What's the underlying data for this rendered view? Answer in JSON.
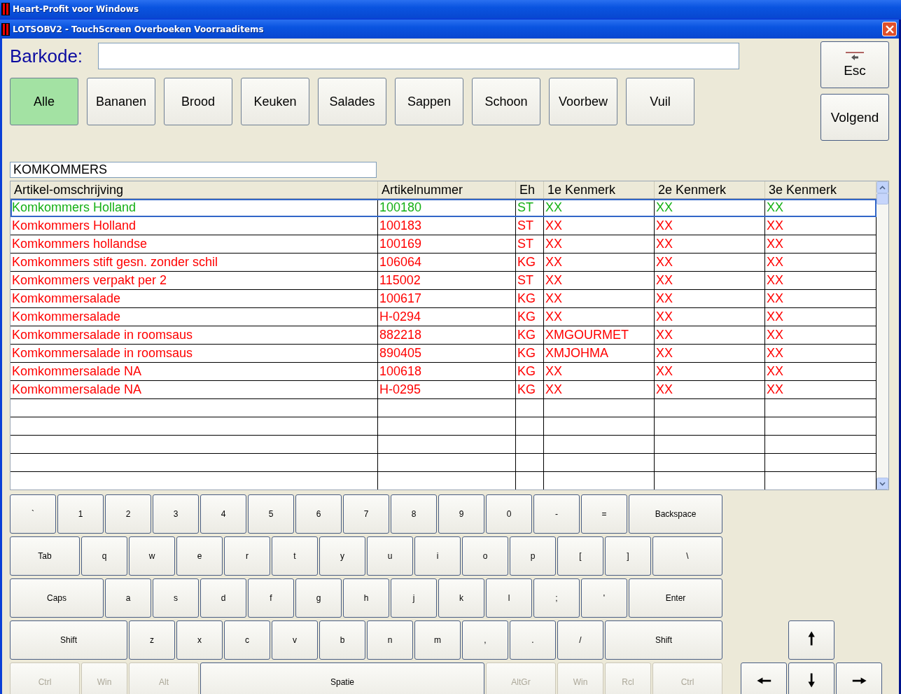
{
  "app_title": "Heart-Profit voor Windows",
  "window": {
    "title": "LOTSOBV2 - TouchScreen Overboeken Voorraaditems"
  },
  "barcode": {
    "label": "Barkode:"
  },
  "categories": [
    {
      "label": "Alle",
      "selected": true
    },
    {
      "label": "Bananen",
      "selected": false
    },
    {
      "label": "Brood",
      "selected": false
    },
    {
      "label": "Keuken",
      "selected": false
    },
    {
      "label": "Salades",
      "selected": false
    },
    {
      "label": "Sappen",
      "selected": false
    },
    {
      "label": "Schoon",
      "selected": false
    },
    {
      "label": "Voorbew",
      "selected": false
    },
    {
      "label": "Vuil",
      "selected": false
    }
  ],
  "side_buttons": [
    "Esc",
    "Volgend"
  ],
  "search": {
    "value": "KOMKOMMERS"
  },
  "table": {
    "columns": [
      "Artikel-omschrijving",
      "Artikelnummer",
      "Eh",
      "1e Kenmerk",
      "2e Kenmerk",
      "3e Kenmerk"
    ],
    "rows": [
      {
        "selected": true,
        "cells": [
          "Komkommers Holland",
          "100180",
          "ST",
          "XX",
          "XX",
          "XX"
        ]
      },
      {
        "selected": false,
        "cells": [
          "Komkommers Holland",
          "100183",
          "ST",
          "XX",
          "XX",
          "XX"
        ]
      },
      {
        "selected": false,
        "cells": [
          "Komkommers hollandse",
          "100169",
          "ST",
          "XX",
          "XX",
          "XX"
        ]
      },
      {
        "selected": false,
        "cells": [
          "Komkommers stift gesn. zonder schil",
          "106064",
          "KG",
          "XX",
          "XX",
          "XX"
        ]
      },
      {
        "selected": false,
        "cells": [
          "Komkommers verpakt per 2",
          "115002",
          "ST",
          "XX",
          "XX",
          "XX"
        ]
      },
      {
        "selected": false,
        "cells": [
          "Komkommersalade",
          "100617",
          "KG",
          "XX",
          "XX",
          "XX"
        ]
      },
      {
        "selected": false,
        "cells": [
          "Komkommersalade",
          "H-0294",
          "KG",
          "XX",
          "XX",
          "XX"
        ]
      },
      {
        "selected": false,
        "cells": [
          "Komkommersalade in roomsaus",
          "882218",
          "KG",
          "XMGOURMET",
          "XX",
          "XX"
        ]
      },
      {
        "selected": false,
        "cells": [
          "Komkommersalade in roomsaus",
          "890405",
          "KG",
          "XMJOHMA",
          "XX",
          "XX"
        ]
      },
      {
        "selected": false,
        "cells": [
          "Komkommersalade NA",
          "100618",
          "KG",
          "XX",
          "XX",
          "XX"
        ]
      },
      {
        "selected": false,
        "cells": [
          "Komkommersalade NA",
          "H-0295",
          "KG",
          "XX",
          "XX",
          "XX"
        ]
      }
    ]
  },
  "keyboard": [
    [
      {
        "label": "`",
        "kind": "key",
        "disabled": false
      },
      {
        "label": "1",
        "kind": "key",
        "disabled": false
      },
      {
        "label": "2",
        "kind": "key",
        "disabled": false
      },
      {
        "label": "3",
        "kind": "key",
        "disabled": false
      },
      {
        "label": "4",
        "kind": "key",
        "disabled": false
      },
      {
        "label": "5",
        "kind": "key",
        "disabled": false
      },
      {
        "label": "6",
        "kind": "key",
        "disabled": false
      },
      {
        "label": "7",
        "kind": "key",
        "disabled": false
      },
      {
        "label": "8",
        "kind": "key",
        "disabled": false
      },
      {
        "label": "9",
        "kind": "key",
        "disabled": false
      },
      {
        "label": "0",
        "kind": "key",
        "disabled": false
      },
      {
        "label": "-",
        "kind": "key",
        "disabled": false
      },
      {
        "label": "=",
        "kind": "key",
        "disabled": false
      },
      {
        "label": "Backspace",
        "kind": "wide",
        "disabled": false
      }
    ],
    [
      {
        "label": "Tab",
        "kind": "medium",
        "disabled": false
      },
      {
        "label": "q",
        "kind": "key",
        "disabled": false
      },
      {
        "label": "w",
        "kind": "key",
        "disabled": false
      },
      {
        "label": "e",
        "kind": "key",
        "disabled": false
      },
      {
        "label": "r",
        "kind": "key",
        "disabled": false
      },
      {
        "label": "t",
        "kind": "key",
        "disabled": false
      },
      {
        "label": "y",
        "kind": "key",
        "disabled": false
      },
      {
        "label": "u",
        "kind": "key",
        "disabled": false
      },
      {
        "label": "i",
        "kind": "key",
        "disabled": false
      },
      {
        "label": "o",
        "kind": "key",
        "disabled": false
      },
      {
        "label": "p",
        "kind": "key",
        "disabled": false
      },
      {
        "label": "[",
        "kind": "key",
        "disabled": false
      },
      {
        "label": "]",
        "kind": "key",
        "disabled": false
      },
      {
        "label": "\\",
        "kind": "medium",
        "disabled": false
      }
    ],
    [
      {
        "label": "Caps",
        "kind": "wide",
        "disabled": false
      },
      {
        "label": "a",
        "kind": "key",
        "disabled": false
      },
      {
        "label": "s",
        "kind": "key",
        "disabled": false
      },
      {
        "label": "d",
        "kind": "key",
        "disabled": false
      },
      {
        "label": "f",
        "kind": "key",
        "disabled": false
      },
      {
        "label": "g",
        "kind": "key",
        "disabled": false
      },
      {
        "label": "h",
        "kind": "key",
        "disabled": false
      },
      {
        "label": "j",
        "kind": "key",
        "disabled": false
      },
      {
        "label": "k",
        "kind": "key",
        "disabled": false
      },
      {
        "label": "l",
        "kind": "key",
        "disabled": false
      },
      {
        "label": ";",
        "kind": "key",
        "disabled": false
      },
      {
        "label": "'",
        "kind": "key",
        "disabled": false
      },
      {
        "label": "Enter",
        "kind": "wide",
        "disabled": false
      }
    ],
    [
      {
        "label": "Shift",
        "kind": "shift",
        "disabled": false
      },
      {
        "label": "z",
        "kind": "key",
        "disabled": false
      },
      {
        "label": "x",
        "kind": "key",
        "disabled": false
      },
      {
        "label": "c",
        "kind": "key",
        "disabled": false
      },
      {
        "label": "v",
        "kind": "key",
        "disabled": false
      },
      {
        "label": "b",
        "kind": "key",
        "disabled": false
      },
      {
        "label": "n",
        "kind": "key",
        "disabled": false
      },
      {
        "label": "m",
        "kind": "key",
        "disabled": false
      },
      {
        "label": ",",
        "kind": "key",
        "disabled": false
      },
      {
        "label": ".",
        "kind": "key",
        "disabled": false
      },
      {
        "label": "/",
        "kind": "key",
        "disabled": false
      },
      {
        "label": "Shift",
        "kind": "shift",
        "disabled": false
      }
    ],
    [
      {
        "label": "Ctrl",
        "kind": "medium",
        "disabled": true
      },
      {
        "label": "Win",
        "kind": "key",
        "disabled": true
      },
      {
        "label": "Alt",
        "kind": "medium",
        "disabled": true
      },
      {
        "label": "Spatie",
        "kind": "space",
        "disabled": false
      },
      {
        "label": "AltGr",
        "kind": "medium",
        "disabled": true
      },
      {
        "label": "Win",
        "kind": "key",
        "disabled": true
      },
      {
        "label": "Rcl",
        "kind": "key",
        "disabled": true
      },
      {
        "label": "Ctrl",
        "kind": "medium",
        "disabled": true
      }
    ]
  ],
  "arrow_keys": {
    "up": "🠕",
    "left": "🠔",
    "down": "🠗",
    "right": "🠖"
  }
}
